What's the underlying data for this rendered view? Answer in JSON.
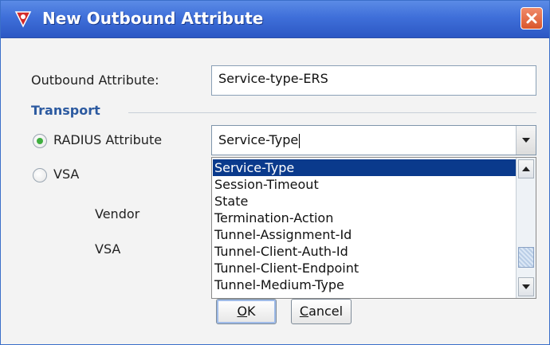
{
  "window": {
    "title": "New Outbound Attribute"
  },
  "form": {
    "outbound_label": "Outbound Attribute:",
    "outbound_value": "Service-type-ERS",
    "transport_label": "Transport",
    "radius_label": "RADIUS Attribute",
    "vsa_label": "VSA",
    "vendor_label": "Vendor",
    "vsa_sub_label": "VSA",
    "combo_value": "Service-Type"
  },
  "dropdown": {
    "items": [
      "Service-Type",
      "Session-Timeout",
      "State",
      "Termination-Action",
      "Tunnel-Assignment-Id",
      "Tunnel-Client-Auth-Id",
      "Tunnel-Client-Endpoint",
      "Tunnel-Medium-Type"
    ]
  },
  "buttons": {
    "ok_mn": "O",
    "ok_rest": "K",
    "cancel_mn": "C",
    "cancel_rest": "ancel"
  },
  "icons": {
    "title_icon": "app-shield-icon",
    "close": "close-icon",
    "dropdown": "chevron-down-icon",
    "scroll_up": "chevron-up-icon",
    "scroll_down": "chevron-down-icon"
  },
  "colors": {
    "title_bar": "#3f6fd9",
    "selection": "#0a3a8c",
    "section_title": "#2c5aa0",
    "close": "#d9562c"
  }
}
